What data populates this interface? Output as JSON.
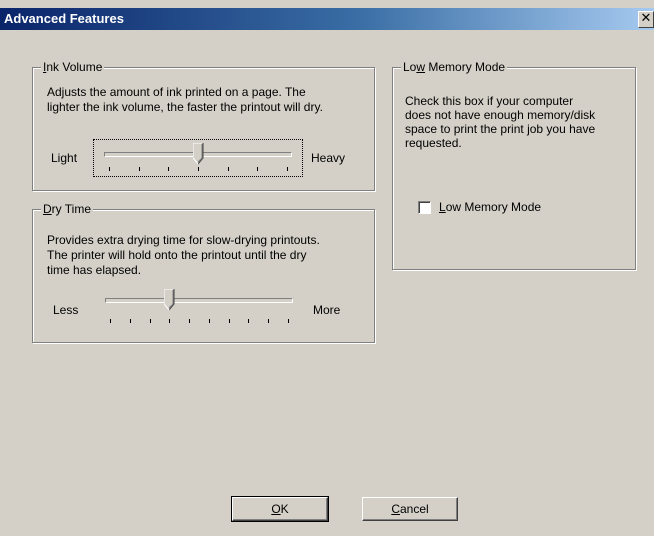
{
  "window": {
    "title": "Advanced Features",
    "close_glyph": "✕"
  },
  "ink_volume": {
    "accel": "I",
    "legend_rest": "nk Volume",
    "description_lines": [
      "Adjusts the amount of ink printed on a page. The",
      "lighter the ink volume, the faster the printout will dry."
    ],
    "min_label": "Light",
    "max_label": "Heavy",
    "tick_count": 7,
    "level": 0.5
  },
  "dry_time": {
    "accel": "D",
    "legend_rest": "ry Time",
    "description_lines": [
      "Provides extra drying time for slow-drying printouts.",
      "The printer will hold onto the printout until the dry",
      "time has elapsed."
    ],
    "min_label": "Less",
    "max_label": "More",
    "tick_count": 10,
    "level": 0.333
  },
  "low_memory": {
    "legend_pre": "Lo",
    "accel": "w",
    "legend_rest": " Memory Mode",
    "description_lines": [
      "Check this box if your computer",
      "does not have enough memory/disk",
      "space to print the print job you have",
      "requested."
    ],
    "checkbox_accel": "L",
    "checkbox_rest": "ow Memory Mode",
    "checked": false
  },
  "buttons": {
    "ok_accel": "O",
    "ok_rest": "K",
    "cancel_accel": "C",
    "cancel_rest": "ancel"
  }
}
